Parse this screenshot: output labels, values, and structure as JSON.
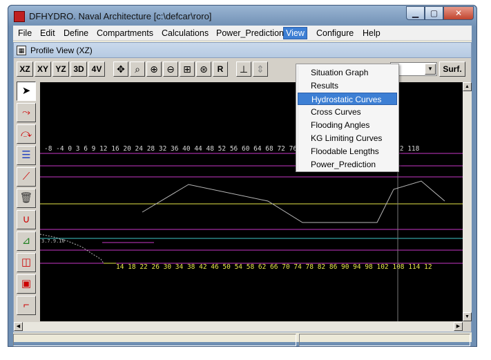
{
  "window": {
    "title": "DFHYDRO. Naval Architecture [c:\\defcar\\roro]"
  },
  "menubar": {
    "items": [
      "File",
      "Edit",
      "Define",
      "Compartments",
      "Calculations",
      "Power_Prediction",
      "View",
      "Configure",
      "Help"
    ]
  },
  "child": {
    "title": "Profile View (XZ)"
  },
  "toolbar": {
    "view_buttons": [
      "XZ",
      "XY",
      "YZ",
      "3D",
      "4V"
    ],
    "reset_label": "R",
    "surf_label": "Surf."
  },
  "view_menu": {
    "items": [
      "Situation Graph",
      "Results",
      "Hydrostatic Curves",
      "Cross Curves",
      "Flooding Angles",
      "KG Limiting Curves",
      "Floodable Lengths",
      "Power_Prediction"
    ],
    "highlighted": "Hydrostatic Curves"
  },
  "canvas": {
    "top_scale": "-8 -4 0 3 6 9 12 16 20 24 28 32 36 40 44 48 52 56 60 64 68 72 76 80 84 88 92 96 100 106 112 118",
    "bottom_scale": "14 18 22 26 30 34 38 42 46 50 54 58 62 66 70 74 78 82 86 90 94 98 102 108 114 12",
    "left_label": "3.7.9.10",
    "colors": {
      "magenta": "#c838c8",
      "yellow": "#e8e84a",
      "cyan": "#40c8c8",
      "profile": "#b8b8b8",
      "scale": "#d8d8d8"
    }
  },
  "icons": {
    "window": [
      "app-icon",
      "minimize-icon",
      "maximize-icon",
      "close-icon"
    ],
    "toolbar": [
      "pan-icon",
      "zoom-icon",
      "zoom-in-icon",
      "zoom-out-icon",
      "zoom-window-icon",
      "zoom-all-icon",
      "section-icon",
      "scroll-icon"
    ],
    "palette": [
      "pointer-icon",
      "curve-icon",
      "curve-edit-icon",
      "layers-icon",
      "line-icon",
      "trash-icon",
      "hull-section-icon",
      "waterplane-icon",
      "box-icon",
      "grid-icon",
      "step-icon"
    ]
  }
}
